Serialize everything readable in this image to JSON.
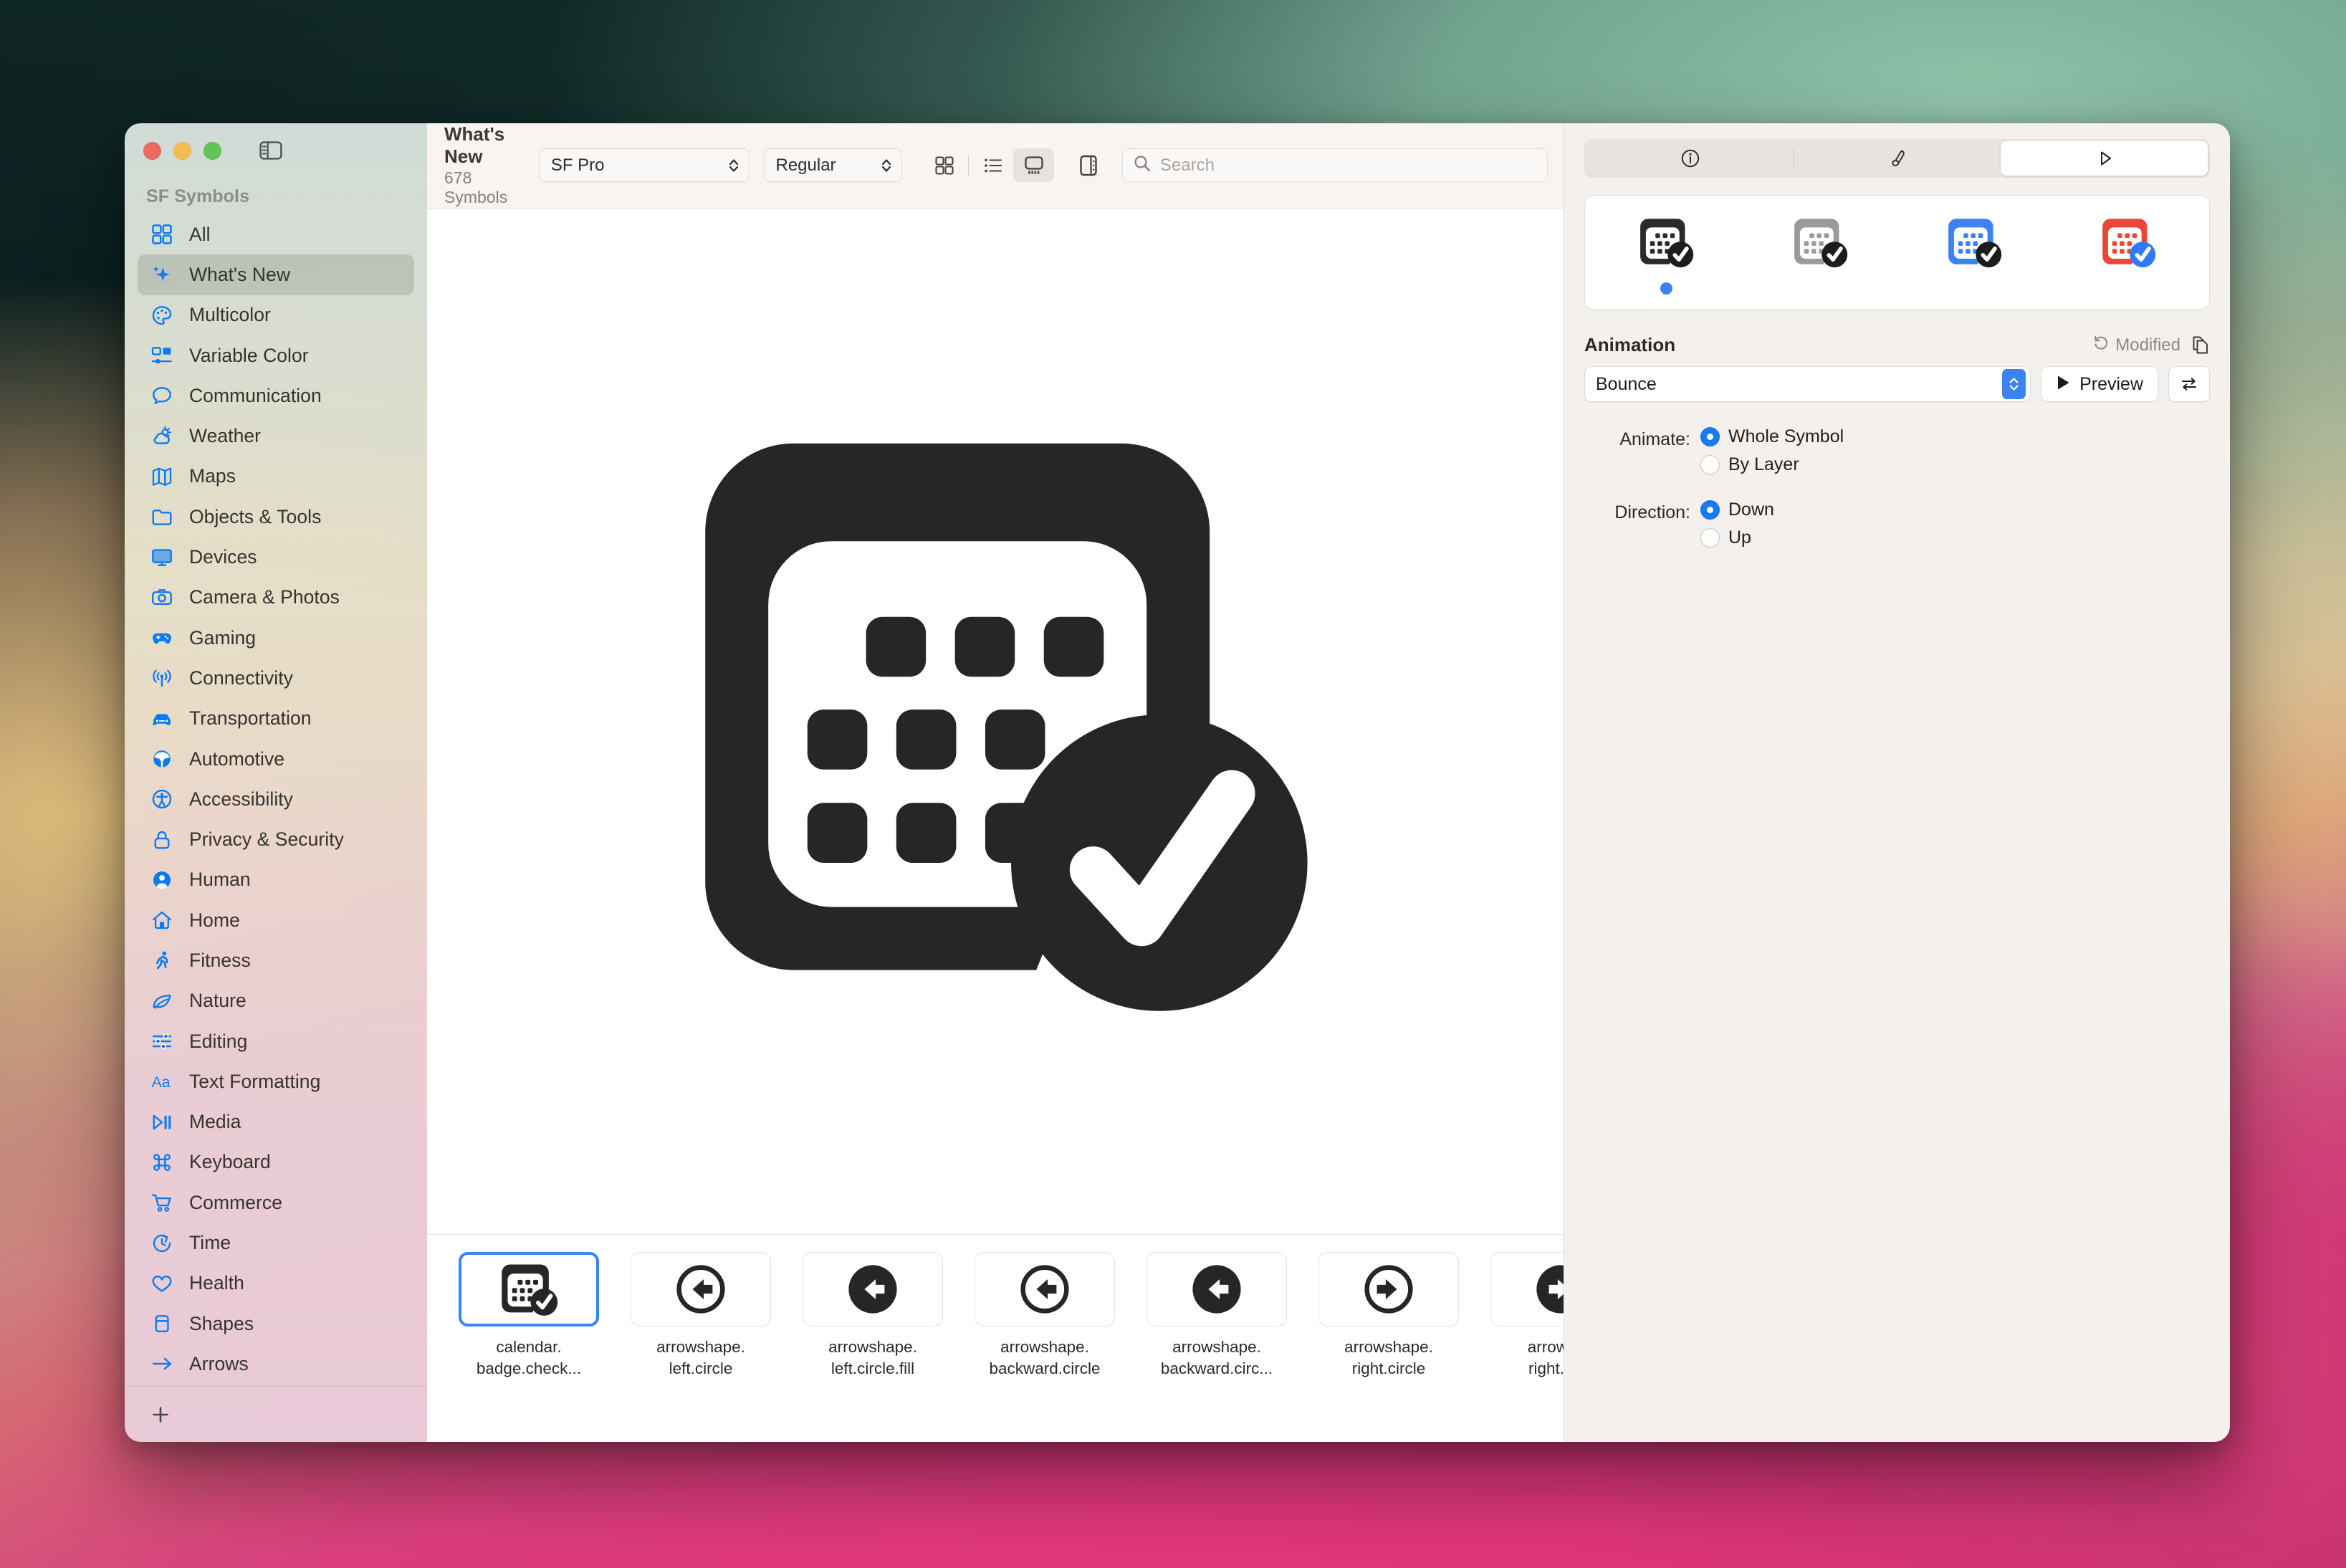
{
  "window": {
    "traffic_lights": [
      "close",
      "minimize",
      "zoom"
    ],
    "sidebar_toggle_icon": "sidebar-toggle-icon"
  },
  "sidebar": {
    "heading": "SF Symbols",
    "items": [
      {
        "label": "All",
        "icon": "grid-icon"
      },
      {
        "label": "What's New",
        "icon": "sparkles-icon",
        "selected": true
      },
      {
        "label": "Multicolor",
        "icon": "palette-icon"
      },
      {
        "label": "Variable Color",
        "icon": "variable-color-icon"
      },
      {
        "label": "Communication",
        "icon": "bubble-icon"
      },
      {
        "label": "Weather",
        "icon": "cloud-sun-icon"
      },
      {
        "label": "Maps",
        "icon": "map-icon"
      },
      {
        "label": "Objects & Tools",
        "icon": "folder-icon"
      },
      {
        "label": "Devices",
        "icon": "display-icon"
      },
      {
        "label": "Camera & Photos",
        "icon": "camera-icon"
      },
      {
        "label": "Gaming",
        "icon": "gamecontroller-icon"
      },
      {
        "label": "Connectivity",
        "icon": "antenna-icon"
      },
      {
        "label": "Transportation",
        "icon": "car-icon"
      },
      {
        "label": "Automotive",
        "icon": "steeringwheel-icon"
      },
      {
        "label": "Accessibility",
        "icon": "accessibility-icon"
      },
      {
        "label": "Privacy & Security",
        "icon": "lock-icon"
      },
      {
        "label": "Human",
        "icon": "person-circle-icon"
      },
      {
        "label": "Home",
        "icon": "house-icon"
      },
      {
        "label": "Fitness",
        "icon": "figure-run-icon"
      },
      {
        "label": "Nature",
        "icon": "leaf-icon"
      },
      {
        "label": "Editing",
        "icon": "sliders-icon"
      },
      {
        "label": "Text Formatting",
        "icon": "textformat-icon"
      },
      {
        "label": "Media",
        "icon": "playpause-icon"
      },
      {
        "label": "Keyboard",
        "icon": "command-icon"
      },
      {
        "label": "Commerce",
        "icon": "cart-icon"
      },
      {
        "label": "Time",
        "icon": "timer-icon"
      },
      {
        "label": "Health",
        "icon": "heart-icon"
      },
      {
        "label": "Shapes",
        "icon": "shapes-icon"
      },
      {
        "label": "Arrows",
        "icon": "arrow-right-icon"
      }
    ],
    "add_button_icon": "plus-icon"
  },
  "toolbar": {
    "title": "What's New",
    "subtitle": "678 Symbols",
    "font_value": "SF Pro",
    "weight_value": "Regular",
    "view_modes": [
      {
        "name": "grid-view",
        "icon": "grid-icon",
        "active": false
      },
      {
        "name": "list-view",
        "icon": "list-icon",
        "active": false
      },
      {
        "name": "gallery-view",
        "icon": "gallery-icon",
        "active": true
      }
    ],
    "panel_toggle_icon": "right-panel-icon",
    "search_placeholder": "Search",
    "search_value": "",
    "search_icon": "search-icon"
  },
  "preview": {
    "symbol_name": "calendar.badge.checkmark",
    "rendering": "monochrome"
  },
  "symbol_strip": {
    "items": [
      {
        "name": "calendar.\nbadge.check...",
        "icon": "calendar-badge-checkmark-icon",
        "selected": true
      },
      {
        "name": "arrowshape.\nleft.circle",
        "icon": "arrowshape-left-circle-icon",
        "selected": false
      },
      {
        "name": "arrowshape.\nleft.circle.fill",
        "icon": "arrowshape-left-circle-fill-icon",
        "selected": false
      },
      {
        "name": "arrowshape.\nbackward.circle",
        "icon": "arrowshape-backward-circle-icon",
        "selected": false
      },
      {
        "name": "arrowshape.\nbackward.circ...",
        "icon": "arrowshape-backward-circle-fill-icon",
        "selected": false
      },
      {
        "name": "arrowshape.\nright.circle",
        "icon": "arrowshape-right-circle-icon",
        "selected": false
      },
      {
        "name": "arrowsha\nright.circl",
        "icon": "arrowshape-right-circle-fill-icon",
        "selected": false
      }
    ]
  },
  "inspector": {
    "tabs": [
      {
        "name": "info-tab",
        "icon": "info-circle-icon",
        "active": false
      },
      {
        "name": "annotate-tab",
        "icon": "paintbrush-icon",
        "active": false
      },
      {
        "name": "animate-tab",
        "icon": "play-triangle-icon",
        "active": true
      }
    ],
    "variants": [
      {
        "name": "monochrome",
        "color": "#2b2b2b",
        "badge_color": "#1c1c1c",
        "selected": true
      },
      {
        "name": "hierarchical",
        "color": "#9a9a9a",
        "badge_color": "#1c1c1c",
        "selected": false
      },
      {
        "name": "palette",
        "color": "#3b82f6",
        "badge_color": "#1c1c1c",
        "selected": false
      },
      {
        "name": "multicolor",
        "color": "#e8483a",
        "badge_color": "#2f7cf6",
        "selected": false
      }
    ],
    "animation": {
      "section_title": "Animation",
      "modified_label": "Modified",
      "modified_icon": "revert-icon",
      "copy_icon": "copy-icon",
      "preset_value": "Bounce",
      "preview_label": "Preview",
      "preview_icon": "play-icon",
      "loop_icon": "repeat-icon",
      "animate_label": "Animate:",
      "animate_options": [
        {
          "label": "Whole Symbol",
          "selected": true
        },
        {
          "label": "By Layer",
          "selected": false
        }
      ],
      "direction_label": "Direction:",
      "direction_options": [
        {
          "label": "Down",
          "selected": true
        },
        {
          "label": "Up",
          "selected": false
        }
      ]
    }
  },
  "colors": {
    "accent_blue": "#3b82f6",
    "sidebar_icon_blue": "#0a7bf5",
    "symbol_dark": "#2b2b2b"
  }
}
